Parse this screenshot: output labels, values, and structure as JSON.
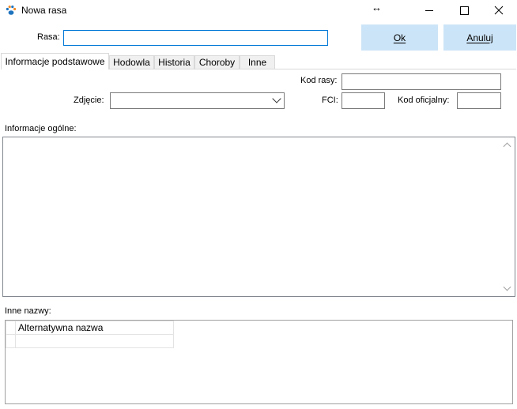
{
  "window": {
    "title": "Nowa rasa",
    "icon": "paw-icon",
    "controls": [
      "minimize",
      "maximize",
      "close"
    ]
  },
  "form": {
    "rasa_label": "Rasa:",
    "rasa_value": "",
    "ok_label": "Ok",
    "cancel_label": "Anuluj"
  },
  "tabs": [
    {
      "label": "Informacje podstawowe",
      "active": true
    },
    {
      "label": "Hodowla",
      "active": false
    },
    {
      "label": "Historia",
      "active": false
    },
    {
      "label": "Choroby",
      "active": false
    },
    {
      "label": "Inne",
      "active": false
    }
  ],
  "basic": {
    "kod_rasy_label": "Kod rasy:",
    "kod_rasy_value": "",
    "zdjecie_label": "Zdjęcie:",
    "zdjecie_value": "",
    "fci_label": "FCI:",
    "fci_value": "",
    "kod_oficjalny_label": "Kod oficjalny:",
    "kod_oficjalny_value": "",
    "info_label": "Informacje ogólne:",
    "info_value": "",
    "inne_nazwy_label": "Inne nazwy:",
    "grid": {
      "columns": [
        "Alternatywna nazwa"
      ],
      "rows": [
        [
          ""
        ]
      ]
    }
  },
  "colors": {
    "button_bg": "#cce4f7",
    "focus_border": "#0078d7"
  }
}
